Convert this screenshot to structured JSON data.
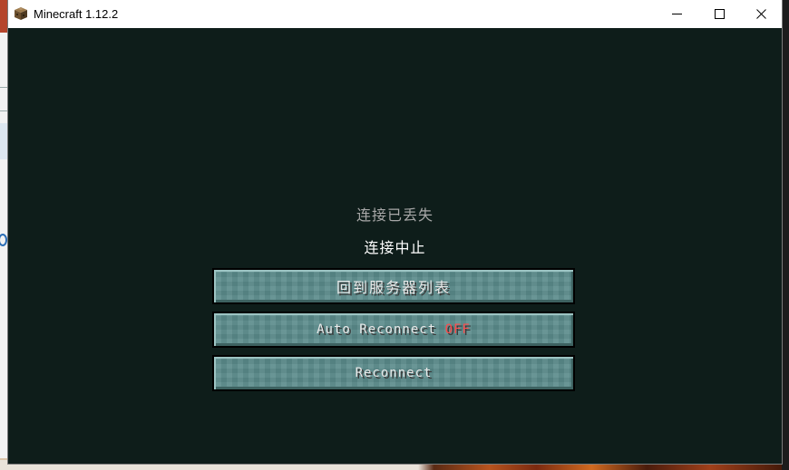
{
  "window": {
    "title": "Minecraft 1.12.2",
    "icon": "minecraft-block-icon"
  },
  "controls": {
    "minimize_icon": "minimize-icon",
    "maximize_icon": "maximize-icon",
    "close_icon": "close-icon"
  },
  "screen": {
    "title": "连接已丢失",
    "reason": "连接中止",
    "buttons": {
      "back_label": "回到服务器列表",
      "auto_reconnect_label": "Auto Reconnect",
      "auto_reconnect_state": "OFF",
      "reconnect_label": "Reconnect"
    }
  },
  "colors": {
    "background": "#0e1d1a",
    "button": "#5b8b8b",
    "off_state": "#ff4b4b"
  }
}
